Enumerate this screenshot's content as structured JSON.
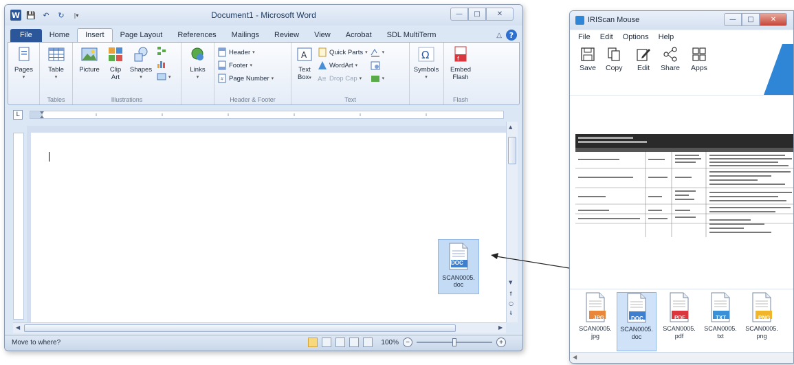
{
  "word": {
    "title": "Document1 - Microsoft Word",
    "tabs": [
      "File",
      "Home",
      "Insert",
      "Page Layout",
      "References",
      "Mailings",
      "Review",
      "View",
      "Acrobat",
      "SDL MultiTerm"
    ],
    "active_tab": "Insert",
    "groups": {
      "pages": {
        "label": "Pages"
      },
      "tables": {
        "label": "Tables",
        "table": "Table"
      },
      "illustrations": {
        "label": "Illustrations",
        "picture": "Picture",
        "clipart_1": "Clip",
        "clipart_2": "Art",
        "shapes": "Shapes"
      },
      "links": {
        "label": "Links"
      },
      "header_footer": {
        "label": "Header & Footer",
        "header": "Header",
        "footer": "Footer",
        "page_number": "Page Number"
      },
      "text": {
        "label": "Text",
        "textbox_1": "Text",
        "textbox_2": "Box",
        "quick_parts": "Quick Parts",
        "wordart": "WordArt",
        "drop_cap": "Drop Cap"
      },
      "symbols": {
        "label": "Symbols"
      },
      "flash": {
        "label": "Flash",
        "embed_1": "Embed",
        "embed_2": "Flash"
      }
    },
    "status": {
      "text": "Move to where?",
      "zoom": "100%"
    },
    "dragged_file": {
      "name_1": "SCAN0005.",
      "name_2": "doc",
      "badge": "DOC"
    }
  },
  "iris": {
    "title": "IRIScan Mouse",
    "menu": [
      "File",
      "Edit",
      "Options",
      "Help"
    ],
    "tools": [
      "Save",
      "Copy",
      "Edit",
      "Share",
      "Apps"
    ],
    "files": [
      {
        "badge": "JPG",
        "name_1": "SCAN0005.",
        "name_2": "jpg",
        "color": "#e8873a"
      },
      {
        "badge": "DOC",
        "name_1": "SCAN0005.",
        "name_2": "doc",
        "color": "#3f7fcf"
      },
      {
        "badge": "PDF",
        "name_1": "SCAN0005.",
        "name_2": "pdf",
        "color": "#d9363e"
      },
      {
        "badge": "TXT",
        "name_1": "SCAN0005.",
        "name_2": "txt",
        "color": "#3a8fd6"
      },
      {
        "badge": "PNG",
        "name_1": "SCAN0005.",
        "name_2": "png",
        "color": "#f0b52a"
      }
    ]
  }
}
